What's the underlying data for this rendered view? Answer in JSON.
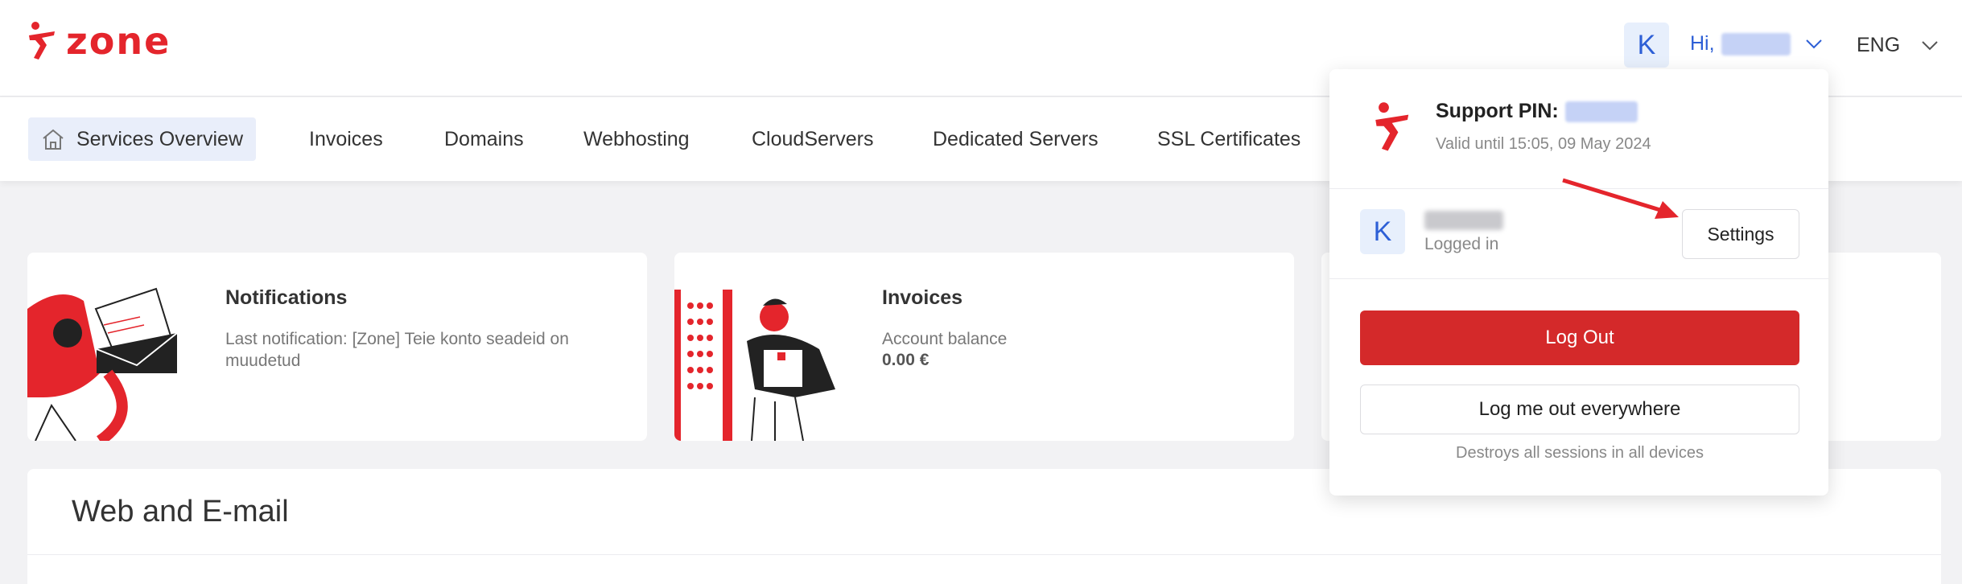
{
  "brand": {
    "name": "zone",
    "color": "#e4252c"
  },
  "header": {
    "avatar_letter": "K",
    "greeting": "Hi,",
    "language": "ENG"
  },
  "nav": {
    "items": [
      {
        "label": "Services Overview",
        "active": true
      },
      {
        "label": "Invoices"
      },
      {
        "label": "Domains"
      },
      {
        "label": "Webhosting"
      },
      {
        "label": "CloudServers"
      },
      {
        "label": "Dedicated Servers"
      },
      {
        "label": "SSL Certificates"
      }
    ]
  },
  "cards": [
    {
      "title": "Notifications",
      "text": "Last notification: [Zone] Teie konto seadeid on muudetud"
    },
    {
      "title": "Invoices",
      "label": "Account balance",
      "value": "0.00 €"
    }
  ],
  "section": {
    "title": "Web and E-mail"
  },
  "dropdown": {
    "pin_label": "Support PIN:",
    "pin_valid": "Valid until 15:05, 09 May 2024",
    "user_avatar_letter": "K",
    "logged_in": "Logged in",
    "settings": "Settings",
    "logout": "Log Out",
    "logout_everywhere": "Log me out everywhere",
    "logout_everywhere_note": "Destroys all sessions in all devices"
  },
  "colors": {
    "accent": "#2d5fd6",
    "danger": "#d4292a",
    "background": "#f2f2f4"
  }
}
